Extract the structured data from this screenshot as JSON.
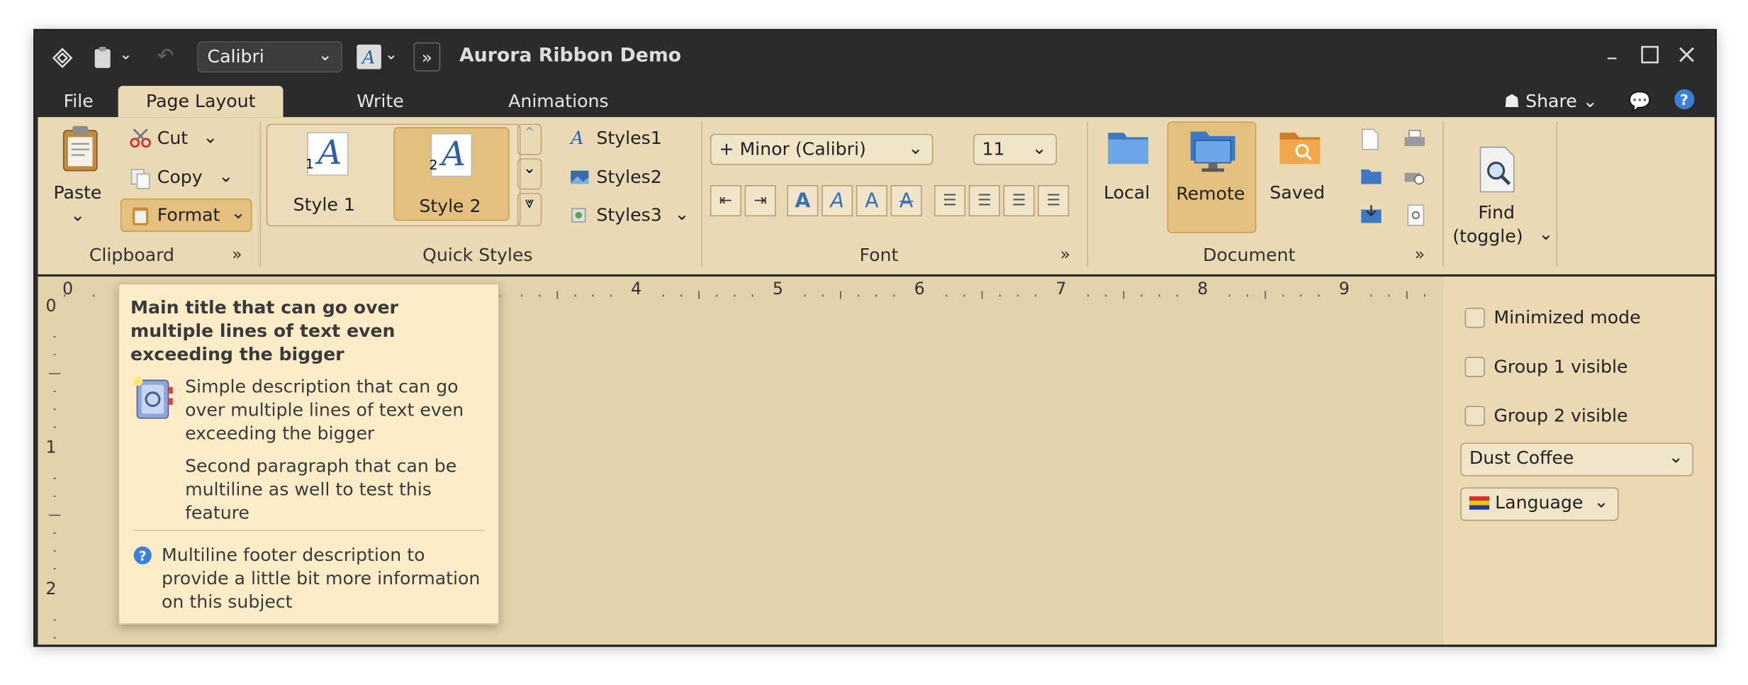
{
  "app": {
    "title": "Aurora Ribbon Demo"
  },
  "qat": {
    "font_value": "Calibri",
    "overflow": "»"
  },
  "tabs": [
    {
      "label": "File"
    },
    {
      "label": "Page Layout"
    },
    {
      "label": "Write"
    },
    {
      "label": "Animations"
    }
  ],
  "share": {
    "label": "Share"
  },
  "clipboard": {
    "paste": "Paste",
    "cut": "Cut",
    "copy": "Copy",
    "format": "Format",
    "group": "Clipboard",
    "more": "»"
  },
  "quick_styles": {
    "style1": "Style 1",
    "style2": "Style 2",
    "style1_num": "1",
    "style2_num": "2",
    "style_glyph": "A",
    "list": [
      "Styles1",
      "Styles2",
      "Styles3"
    ],
    "group": "Quick Styles"
  },
  "font": {
    "family": "+ Minor (Calibri)",
    "size": "11",
    "group": "Font",
    "more": "»"
  },
  "document": {
    "local": "Local",
    "remote": "Remote",
    "saved": "Saved",
    "group": "Document",
    "more": "»"
  },
  "find": {
    "line1": "Find",
    "line2": "(toggle)"
  },
  "ruler": {
    "h": [
      "0",
      "4",
      "5",
      "6",
      "7",
      "8",
      "9"
    ],
    "v": [
      "0",
      "1",
      "2"
    ]
  },
  "side": {
    "minimized": "Minimized mode",
    "group1": "Group 1 visible",
    "group2": "Group 2 visible",
    "skin": "Dust Coffee",
    "language": "Language"
  },
  "tooltip": {
    "title": "Main title that can go over multiple lines of text even exceeding the bigger",
    "desc1": "Simple description that can go over multiple lines of text even exceeding the bigger",
    "desc2": "Second paragraph that can be multiline as well to test this feature",
    "footer": "Multiline footer description to provide a little bit more information on this subject"
  },
  "colors": {
    "ribbon_bg": "#e9d9b4",
    "title_bg": "#2b2b2b",
    "highlight": "#e4c07f",
    "content_bg": "#e1d2aa"
  }
}
